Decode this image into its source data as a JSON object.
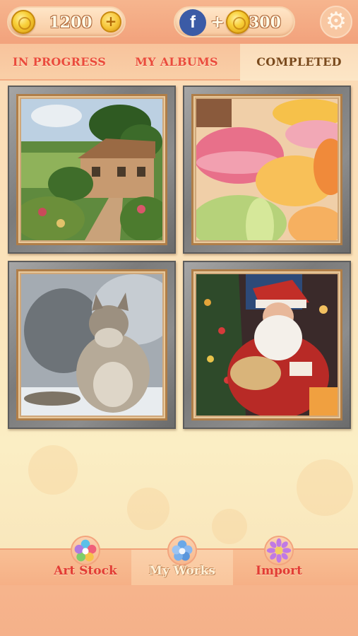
{
  "header": {
    "coin_balance": "1200",
    "add_coins_icon": "plus-icon",
    "facebook_icon_letter": "f",
    "facebook_plus": "+",
    "facebook_reward": "300",
    "settings_icon": "gear-icon"
  },
  "tabs": [
    {
      "label": "IN PROGRESS",
      "active": false
    },
    {
      "label": "MY ALBUMS",
      "active": false
    },
    {
      "label": "COMPLETED",
      "active": true
    }
  ],
  "gallery": {
    "items": [
      {
        "subject": "cottage-garden-painting"
      },
      {
        "subject": "macarons-painting"
      },
      {
        "subject": "cat-painting"
      },
      {
        "subject": "santa-claus-painting"
      }
    ]
  },
  "bottom_nav": {
    "items": [
      {
        "label": "Art Stock",
        "icon": "flower-icon",
        "active": false
      },
      {
        "label": "My Works",
        "icon": "folder-flower-icon",
        "active": true
      },
      {
        "label": "Import",
        "icon": "sunflower-icon",
        "active": false
      }
    ]
  },
  "colors": {
    "accent_red": "#ea4b3c",
    "header_bg": "#f6b58e",
    "background": "#fbe3ba",
    "facebook_blue": "#3b5ba6",
    "coin_gold": "#f8cf38"
  }
}
